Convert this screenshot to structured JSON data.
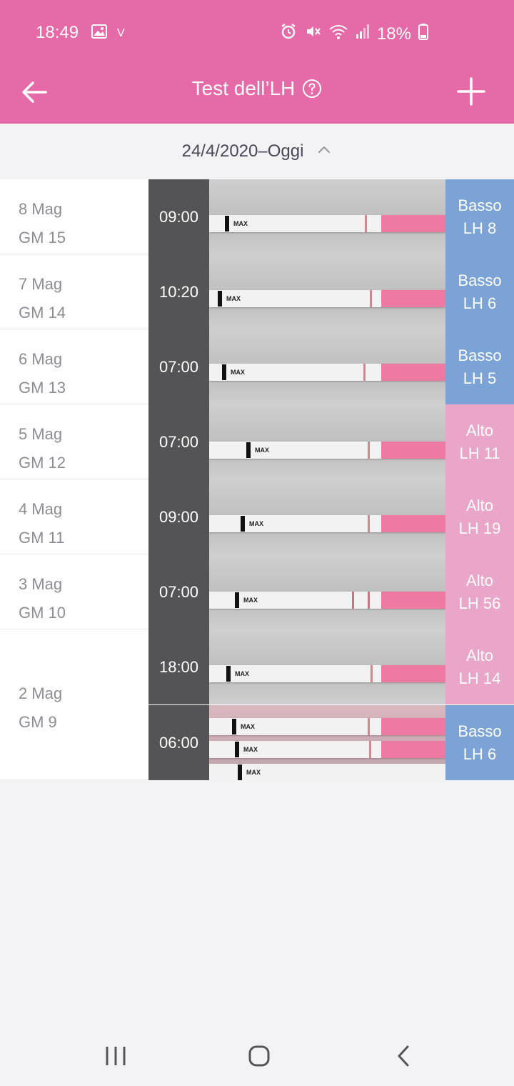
{
  "status_bar": {
    "time": "18:49",
    "carrier_mark": "V",
    "battery": "18%",
    "icons": [
      "image-icon",
      "alarm-icon",
      "mute-icon",
      "wifi-icon",
      "signal-icon",
      "battery-icon"
    ]
  },
  "app_bar": {
    "title": "Test dell’LH",
    "back_icon": "arrow-left-icon",
    "help_icon": "help-circle-icon",
    "add_icon": "plus-icon"
  },
  "range": {
    "label": "24/4/2020–Oggi",
    "icon": "chevron-up-icon"
  },
  "colors": {
    "brand": "#e66aa8",
    "low": "#7ba3d6",
    "high": "#e9a6c8"
  },
  "days": [
    {
      "date": "8 Mag",
      "cycle_day": "GM 15",
      "tests": [
        {
          "time": "09:00",
          "level": "Basso",
          "lh": "LH 8",
          "status": "low"
        }
      ]
    },
    {
      "date": "7 Mag",
      "cycle_day": "GM 14",
      "tests": [
        {
          "time": "10:20",
          "level": "Basso",
          "lh": "LH 6",
          "status": "low"
        }
      ]
    },
    {
      "date": "6 Mag",
      "cycle_day": "GM 13",
      "tests": [
        {
          "time": "07:00",
          "level": "Basso",
          "lh": "LH 5",
          "status": "low"
        }
      ]
    },
    {
      "date": "5 Mag",
      "cycle_day": "GM 12",
      "tests": [
        {
          "time": "07:00",
          "level": "Alto",
          "lh": "LH 11",
          "status": "high"
        }
      ]
    },
    {
      "date": "4 Mag",
      "cycle_day": "GM 11",
      "tests": [
        {
          "time": "09:00",
          "level": "Alto",
          "lh": "LH 19",
          "status": "high"
        }
      ]
    },
    {
      "date": "3 Mag",
      "cycle_day": "GM 10",
      "tests": [
        {
          "time": "07:00",
          "level": "Alto",
          "lh": "LH 56",
          "status": "high"
        }
      ]
    },
    {
      "date": "2 Mag",
      "cycle_day": "GM 9",
      "tests": [
        {
          "time": "18:00",
          "level": "Alto",
          "lh": "LH 14",
          "status": "high"
        },
        {
          "time": "06:00",
          "level": "Basso",
          "lh": "LH 6",
          "status": "low"
        }
      ]
    }
  ],
  "strip_marker_text": "MAX",
  "nav_bar": [
    "recent-apps-icon",
    "home-icon",
    "back-icon"
  ]
}
